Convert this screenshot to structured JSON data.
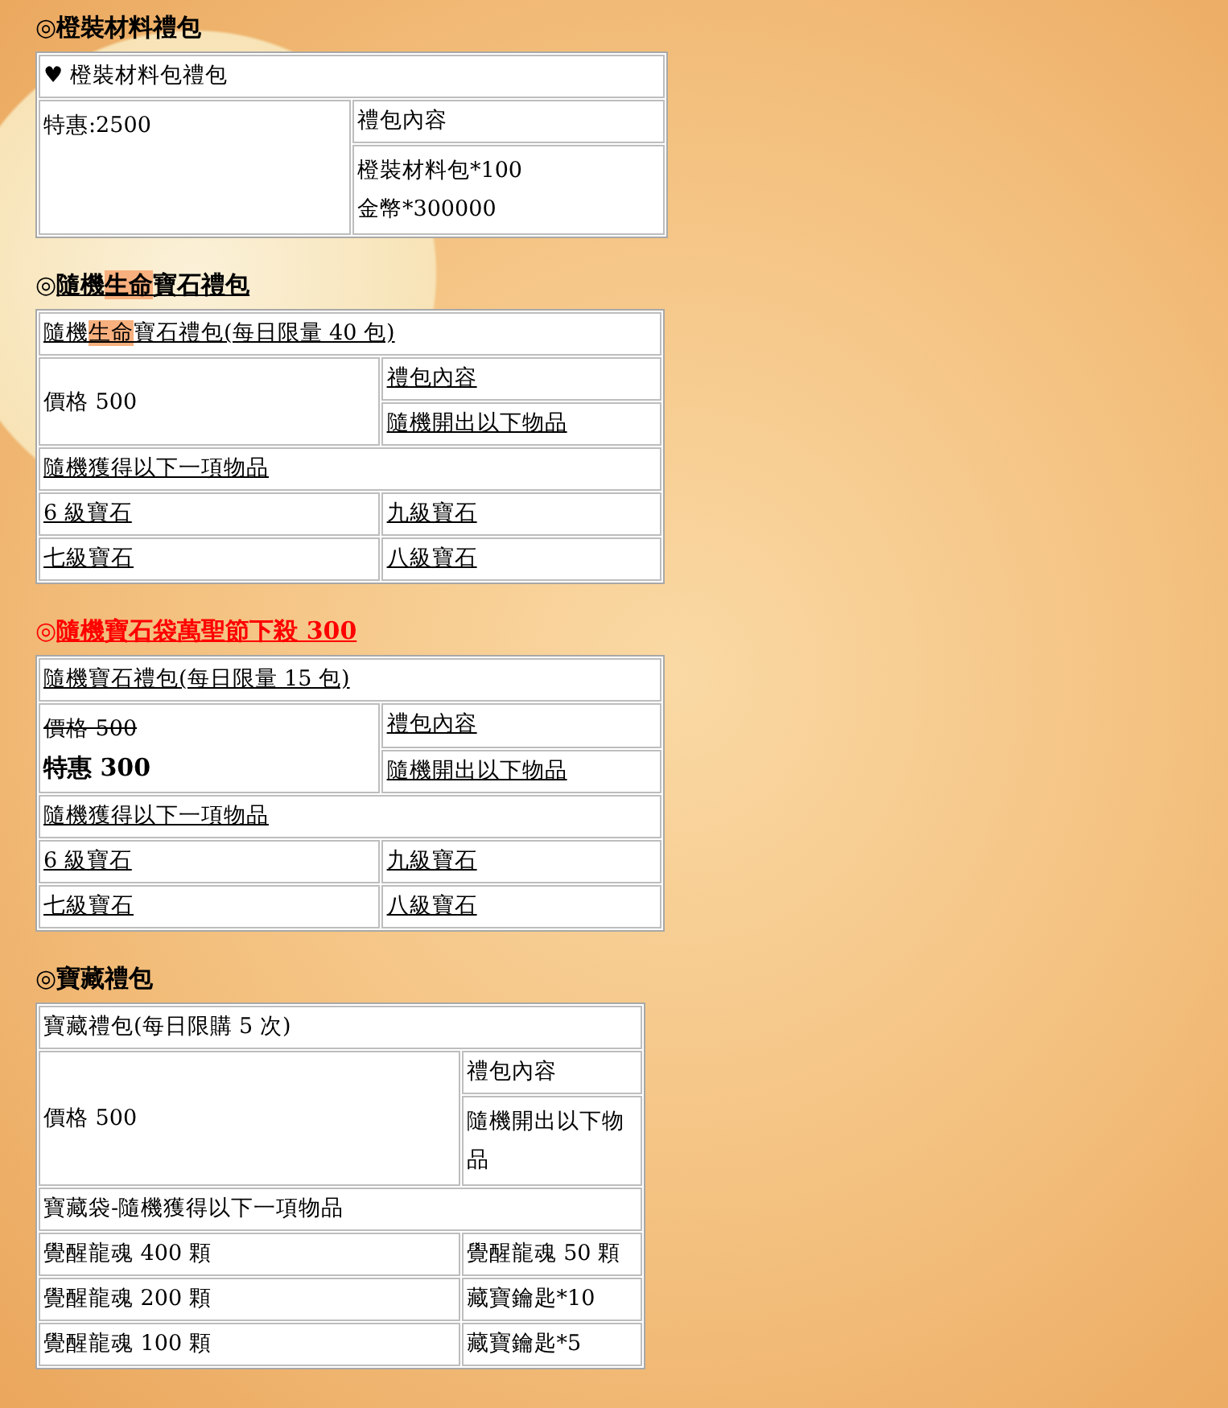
{
  "sections": [
    {
      "heading": {
        "marker": "◎",
        "parts": [
          {
            "text": "橙裝材料禮包",
            "highlight": false
          }
        ],
        "color": "#000000"
      },
      "linked": false,
      "table": {
        "header": [
          {
            "text": "♥ 橙裝材料包禮包",
            "highlight": false
          }
        ],
        "price": [
          {
            "text": "特惠:2500",
            "struck": false,
            "bold": false
          }
        ],
        "label": "禮包內容",
        "contents": [
          "橙裝材料包*100",
          "金幣*300000"
        ]
      }
    },
    {
      "heading": {
        "marker": "◎",
        "parts": [
          {
            "text": "隨機",
            "highlight": false
          },
          {
            "text": "生命",
            "highlight": true
          },
          {
            "text": "寶石禮包",
            "highlight": false
          }
        ],
        "color": "#000000"
      },
      "linked": true,
      "table": {
        "header": [
          {
            "text": "隨機",
            "highlight": false
          },
          {
            "text": "生命",
            "highlight": true
          },
          {
            "text": "寶石禮包(每日限量 40 包)",
            "highlight": false
          }
        ],
        "price": [
          {
            "text": "價格 500",
            "struck": false,
            "bold": false
          }
        ],
        "label": "禮包內容",
        "contents": [
          "隨機開出以下物品"
        ],
        "list_title": "隨機獲得以下一項物品",
        "items": [
          {
            "left": "6 級寶石",
            "right": "九級寶石"
          },
          {
            "left": "七級寶石",
            "right": "八級寶石"
          }
        ]
      }
    },
    {
      "heading": {
        "marker": "◎",
        "parts": [
          {
            "text": "隨機寶石袋萬聖節下殺 300",
            "highlight": false
          }
        ],
        "color": "#ff0000"
      },
      "linked": true,
      "table": {
        "header": [
          {
            "text": "隨機寶石禮包(每日限量 15 包)",
            "highlight": false
          }
        ],
        "price": [
          {
            "text": "價格 500",
            "struck": true,
            "bold": false
          },
          {
            "text": "特惠 300",
            "struck": false,
            "bold": true
          }
        ],
        "label": "禮包內容",
        "contents": [
          "隨機開出以下物品"
        ],
        "list_title": "隨機獲得以下一項物品",
        "items": [
          {
            "left": "6 級寶石",
            "right": "九級寶石"
          },
          {
            "left": "七級寶石",
            "right": "八級寶石"
          }
        ]
      }
    },
    {
      "heading": {
        "marker": "◎",
        "parts": [
          {
            "text": "寶藏禮包",
            "highlight": false
          }
        ],
        "color": "#000000"
      },
      "linked": false,
      "table": {
        "header": [
          {
            "text": "寶藏禮包(每日限購 5 次)",
            "highlight": false
          }
        ],
        "price": [
          {
            "text": "價格 500",
            "struck": false,
            "bold": false
          }
        ],
        "label": "禮包內容",
        "contents": [
          "隨機開出以下物品"
        ],
        "list_title": "寶藏袋-隨機獲得以下一項物品",
        "items": [
          {
            "left": "覺醒龍魂 400 顆",
            "right": "覺醒龍魂 50 顆"
          },
          {
            "left": "覺醒龍魂 200 顆",
            "right": "藏寶鑰匙*10"
          },
          {
            "left": "覺醒龍魂 100 顆",
            "right": "藏寶鑰匙*5"
          }
        ]
      }
    }
  ]
}
